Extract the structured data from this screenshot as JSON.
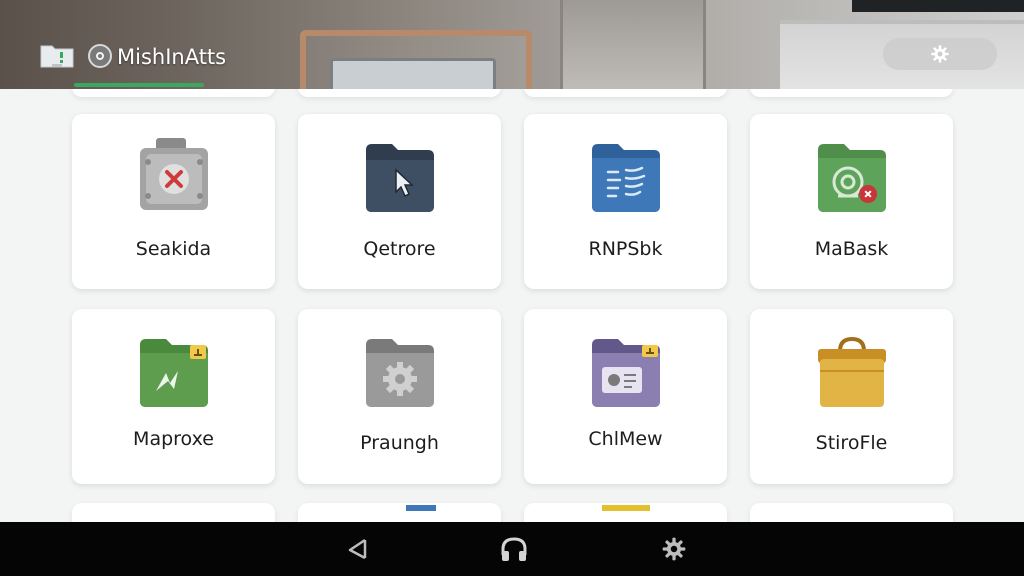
{
  "header": {
    "app_title": "MishInAtts",
    "app_icon": "folder-app-icon",
    "brand_icon": "camera-circle-icon",
    "settings_icon": "gear-icon"
  },
  "tiles": [
    {
      "label": "Seakida",
      "icon": "gray-folder-x-icon",
      "color": "#9a9a9a"
    },
    {
      "label": "Qetrore",
      "icon": "dark-folder-cursor-icon",
      "color": "#3f4f63"
    },
    {
      "label": "RNPSbk",
      "icon": "blue-folder-lines-icon",
      "color": "#3f78b8"
    },
    {
      "label": "MaBask",
      "icon": "green-folder-badge-icon",
      "color": "#5ea35a"
    },
    {
      "label": "Maproxe",
      "icon": "green-folder-arrows-icon",
      "color": "#5e9c4e"
    },
    {
      "label": "Praungh",
      "icon": "gray-folder-gear-icon",
      "color": "#8c8c8c"
    },
    {
      "label": "ChlMew",
      "icon": "purple-folder-card-icon",
      "color": "#7e72a4"
    },
    {
      "label": "StiroFle",
      "icon": "yellow-box-folder-icon",
      "color": "#d8a437"
    }
  ],
  "navbar": {
    "back_icon": "back-triangle-icon",
    "home_icon": "headphones-home-icon",
    "settings_icon": "gear-icon"
  }
}
